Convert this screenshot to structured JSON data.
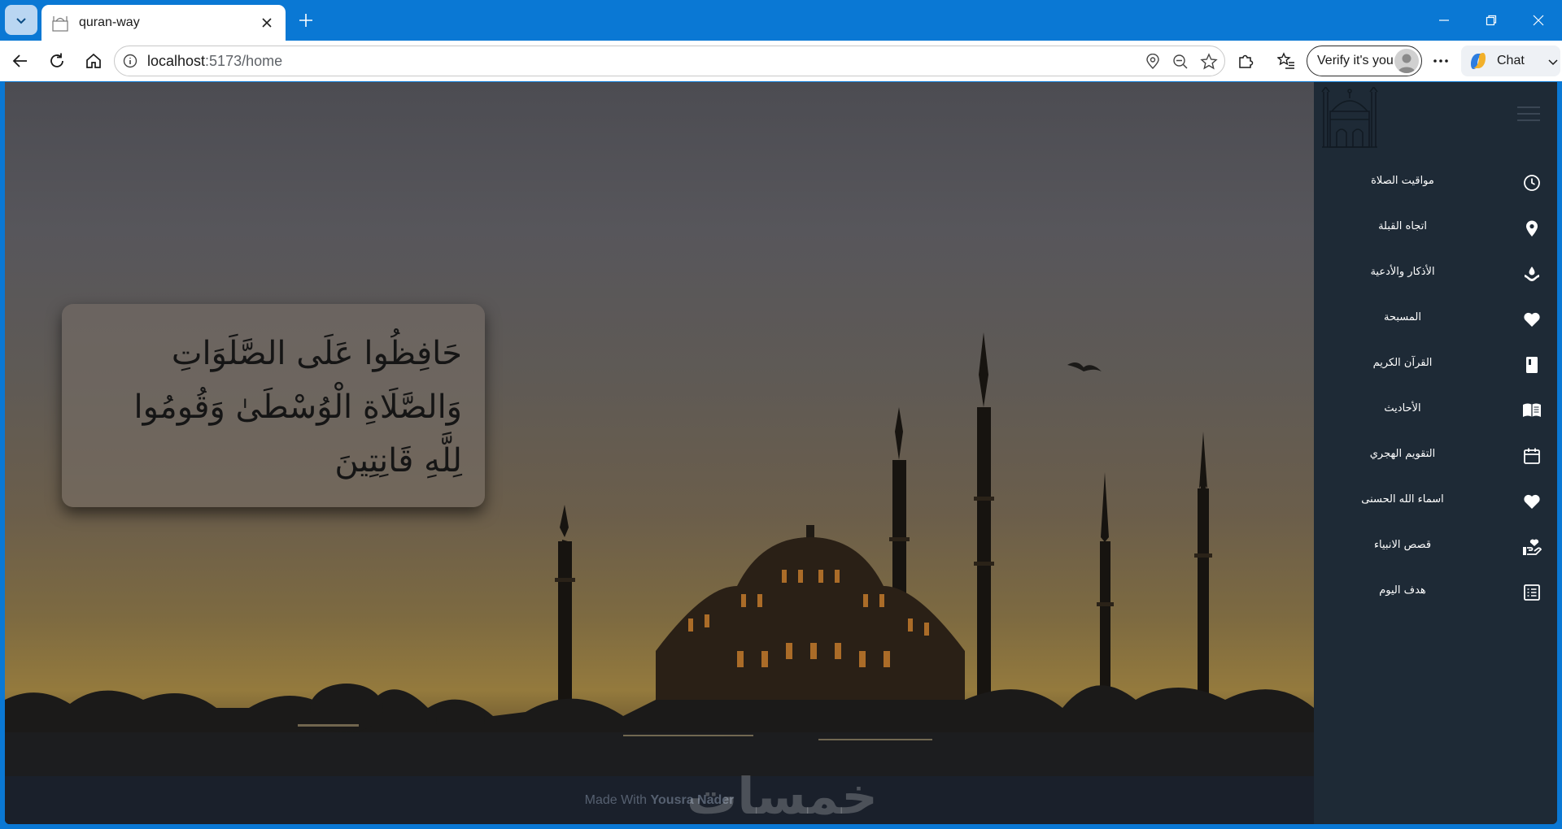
{
  "browser": {
    "tab_title": "quran-way",
    "address_host": "localhost",
    "address_path": ":5173/home",
    "verify_label": "Verify it's you",
    "chat_label": "Chat"
  },
  "hero": {
    "verse_lines": [
      "حَافِظُوا عَلَى الصَّلَوَاتِ",
      "وَالصَّلَاةِ الْوُسْطَىٰ وَقُومُوا",
      "لِلَّهِ قَانِتِينَ"
    ]
  },
  "footer": {
    "prefix": "Made With",
    "author": "Yousra Nader",
    "watermark": "خمسات"
  },
  "sidebar": {
    "items": [
      {
        "label": "مواقيت الصلاة",
        "icon": "clock-icon"
      },
      {
        "label": "اتجاه القبلة",
        "icon": "location-pin-icon"
      },
      {
        "label": "الأذكار والأدعية",
        "icon": "hand-drop-icon"
      },
      {
        "label": "المسبحة",
        "icon": "heart-icon"
      },
      {
        "label": "القرآن الكريم",
        "icon": "book-icon"
      },
      {
        "label": "الأحاديث",
        "icon": "open-book-icon"
      },
      {
        "label": "التقويم الهجري",
        "icon": "calendar-icon"
      },
      {
        "label": "اسماء الله الحسنى",
        "icon": "heart-icon"
      },
      {
        "label": "قصص الانبياء",
        "icon": "hand-heart-icon"
      },
      {
        "label": "هدف اليوم",
        "icon": "checklist-icon"
      }
    ]
  },
  "colors": {
    "sidebar_bg": "#1e2a36",
    "browser_accent": "#0a78d4",
    "footer_bg": "#1a212c"
  }
}
